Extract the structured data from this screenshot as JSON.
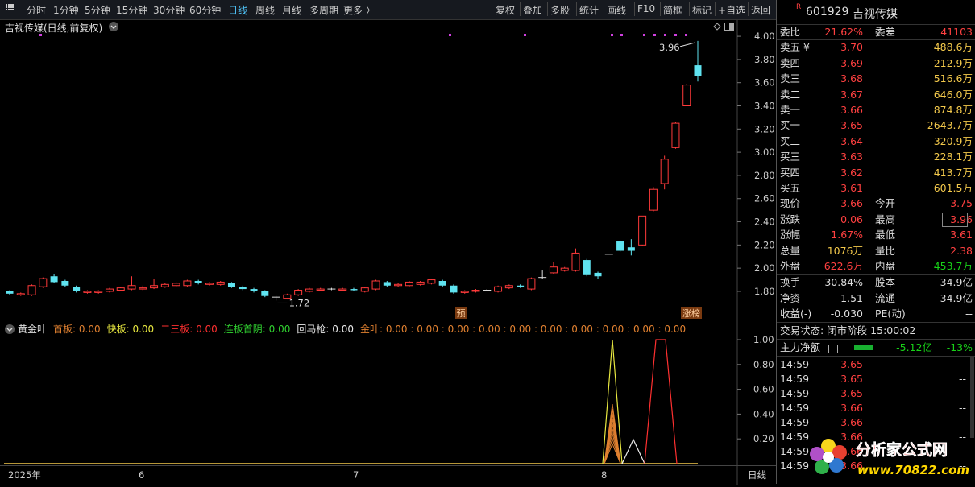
{
  "toolbar": {
    "periods": [
      "分时",
      "1分钟",
      "5分钟",
      "15分钟",
      "30分钟",
      "60分钟",
      "日线",
      "周线",
      "月线",
      "多周期",
      "更多 〉"
    ],
    "active_period": "日线",
    "right_buttons": [
      "复权",
      "叠加",
      "多股",
      "统计",
      "画线",
      "F10",
      "简框",
      "标记",
      "+自选",
      "返回"
    ]
  },
  "main_chart": {
    "title": "吉视传媒(日线,前复权)",
    "price_axis": [
      "4.00",
      "3.80",
      "3.60",
      "3.40",
      "3.20",
      "3.00",
      "2.80",
      "2.60",
      "2.40",
      "2.20",
      "2.00",
      "1.80"
    ],
    "high_label": "3.96",
    "low_label": "1.72",
    "markers": [
      "预",
      "涨榜"
    ]
  },
  "chart_data": {
    "type": "candlestick",
    "ylim": [
      1.72,
      4.05
    ],
    "candles": [
      {
        "o": 1.8,
        "c": 1.78,
        "h": 1.81,
        "l": 1.77
      },
      {
        "o": 1.77,
        "c": 1.78,
        "h": 1.79,
        "l": 1.76
      },
      {
        "o": 1.77,
        "c": 1.85,
        "h": 1.86,
        "l": 1.76
      },
      {
        "o": 1.84,
        "c": 1.91,
        "h": 1.92,
        "l": 1.83
      },
      {
        "o": 1.93,
        "c": 1.88,
        "h": 1.95,
        "l": 1.87
      },
      {
        "o": 1.89,
        "c": 1.85,
        "h": 1.9,
        "l": 1.84
      },
      {
        "o": 1.84,
        "c": 1.8,
        "h": 1.85,
        "l": 1.79
      },
      {
        "o": 1.79,
        "c": 1.8,
        "h": 1.81,
        "l": 1.78
      },
      {
        "o": 1.79,
        "c": 1.8,
        "h": 1.81,
        "l": 1.78
      },
      {
        "o": 1.8,
        "c": 1.82,
        "h": 1.83,
        "l": 1.79
      },
      {
        "o": 1.81,
        "c": 1.83,
        "h": 1.84,
        "l": 1.8
      },
      {
        "o": 1.82,
        "c": 1.85,
        "h": 1.93,
        "l": 1.81
      },
      {
        "o": 1.82,
        "c": 1.83,
        "h": 1.85,
        "l": 1.81
      },
      {
        "o": 1.83,
        "c": 1.85,
        "h": 1.91,
        "l": 1.82
      },
      {
        "o": 1.84,
        "c": 1.86,
        "h": 1.87,
        "l": 1.83
      },
      {
        "o": 1.85,
        "c": 1.87,
        "h": 1.88,
        "l": 1.84
      },
      {
        "o": 1.85,
        "c": 1.89,
        "h": 1.9,
        "l": 1.84
      },
      {
        "o": 1.89,
        "c": 1.87,
        "h": 1.9,
        "l": 1.86
      },
      {
        "o": 1.86,
        "c": 1.87,
        "h": 1.88,
        "l": 1.85
      },
      {
        "o": 1.86,
        "c": 1.88,
        "h": 1.89,
        "l": 1.85
      },
      {
        "o": 1.87,
        "c": 1.84,
        "h": 1.88,
        "l": 1.83
      },
      {
        "o": 1.84,
        "c": 1.82,
        "h": 1.85,
        "l": 1.81
      },
      {
        "o": 1.82,
        "c": 1.8,
        "h": 1.83,
        "l": 1.79
      },
      {
        "o": 1.8,
        "c": 1.76,
        "h": 1.81,
        "l": 1.75
      },
      {
        "o": 1.75,
        "c": 1.75,
        "h": 1.76,
        "l": 1.72
      },
      {
        "o": 1.74,
        "c": 1.77,
        "h": 1.78,
        "l": 1.73
      },
      {
        "o": 1.77,
        "c": 1.81,
        "h": 1.82,
        "l": 1.76
      },
      {
        "o": 1.8,
        "c": 1.82,
        "h": 1.83,
        "l": 1.79
      },
      {
        "o": 1.81,
        "c": 1.82,
        "h": 1.83,
        "l": 1.8
      },
      {
        "o": 1.82,
        "c": 1.82,
        "h": 1.83,
        "l": 1.81
      },
      {
        "o": 1.81,
        "c": 1.82,
        "h": 1.83,
        "l": 1.8
      },
      {
        "o": 1.82,
        "c": 1.81,
        "h": 1.83,
        "l": 1.8
      },
      {
        "o": 1.8,
        "c": 1.83,
        "h": 1.84,
        "l": 1.79
      },
      {
        "o": 1.82,
        "c": 1.89,
        "h": 1.9,
        "l": 1.81
      },
      {
        "o": 1.88,
        "c": 1.85,
        "h": 1.89,
        "l": 1.84
      },
      {
        "o": 1.85,
        "c": 1.86,
        "h": 1.87,
        "l": 1.84
      },
      {
        "o": 1.85,
        "c": 1.88,
        "h": 1.89,
        "l": 1.84
      },
      {
        "o": 1.86,
        "c": 1.88,
        "h": 1.89,
        "l": 1.85
      },
      {
        "o": 1.87,
        "c": 1.9,
        "h": 1.91,
        "l": 1.86
      },
      {
        "o": 1.89,
        "c": 1.85,
        "h": 1.9,
        "l": 1.84
      },
      {
        "o": 1.85,
        "c": 1.79,
        "h": 1.86,
        "l": 1.78
      },
      {
        "o": 1.79,
        "c": 1.8,
        "h": 1.81,
        "l": 1.78
      },
      {
        "o": 1.8,
        "c": 1.81,
        "h": 1.82,
        "l": 1.79
      },
      {
        "o": 1.81,
        "c": 1.81,
        "h": 1.82,
        "l": 1.8
      },
      {
        "o": 1.8,
        "c": 1.84,
        "h": 1.85,
        "l": 1.79
      },
      {
        "o": 1.83,
        "c": 1.85,
        "h": 1.86,
        "l": 1.82
      },
      {
        "o": 1.85,
        "c": 1.84,
        "h": 1.86,
        "l": 1.83
      },
      {
        "o": 1.82,
        "c": 1.91,
        "h": 1.92,
        "l": 1.81
      },
      {
        "o": 1.92,
        "c": 1.92,
        "h": 1.98,
        "l": 1.91
      },
      {
        "o": 1.96,
        "c": 2.01,
        "h": 2.05,
        "l": 1.95
      },
      {
        "o": 1.98,
        "c": 2.0,
        "h": 2.01,
        "l": 1.97
      },
      {
        "o": 1.98,
        "c": 2.13,
        "h": 2.17,
        "l": 1.97
      },
      {
        "o": 2.07,
        "c": 1.94,
        "h": 2.08,
        "l": 1.93
      },
      {
        "o": 1.96,
        "c": 1.93,
        "h": 1.97,
        "l": 1.91
      },
      {
        "o": 2.12,
        "c": 2.12,
        "h": 2.12,
        "l": 2.12
      },
      {
        "o": 2.23,
        "c": 2.15,
        "h": 2.24,
        "l": 2.14
      },
      {
        "o": 2.18,
        "c": 2.15,
        "h": 2.25,
        "l": 2.11
      },
      {
        "o": 2.2,
        "c": 2.45,
        "h": 2.45,
        "l": 2.19
      },
      {
        "o": 2.5,
        "c": 2.68,
        "h": 2.7,
        "l": 2.49
      },
      {
        "o": 2.73,
        "c": 2.94,
        "h": 2.97,
        "l": 2.68
      },
      {
        "o": 3.04,
        "c": 3.25,
        "h": 3.26,
        "l": 3.03
      },
      {
        "o": 3.4,
        "c": 3.58,
        "h": 3.59,
        "l": 3.4
      },
      {
        "o": 3.75,
        "c": 3.66,
        "h": 3.96,
        "l": 3.61
      }
    ]
  },
  "indicator": {
    "name": "黄金叶",
    "items": [
      {
        "label": "首板:",
        "value": "0.00",
        "color": "#e08030"
      },
      {
        "label": "快板:",
        "value": "0.00",
        "color": "#e8e840"
      },
      {
        "label": "二三板:",
        "value": "0.00",
        "color": "#ff3030"
      },
      {
        "label": "连板首阴:",
        "value": "0.00",
        "color": "#30d030"
      },
      {
        "label": "回马枪:",
        "value": "0.00",
        "color": "#e8e8e8"
      },
      {
        "label": "金叶:",
        "value": "0.00 : 0.00 : 0.00 : 0.00 : 0.00 : 0.00 : 0.00 : 0.00 : 0.00 : 0.00",
        "color": "#e08030"
      }
    ],
    "axis": [
      "1.00",
      "0.80",
      "0.60",
      "0.40",
      "0.20"
    ]
  },
  "x_axis": {
    "labels": [
      "2025年",
      "6",
      "7",
      "8"
    ],
    "period": "日线"
  },
  "quote": {
    "code": "601929",
    "name": "吉视传媒",
    "tag": "R",
    "weibi_label": "委比",
    "weibi": "21.62%",
    "weicha_label": "委差",
    "weicha": "41103",
    "asks": [
      {
        "label": "卖五 ¥",
        "price": "3.70",
        "vol": "488.6万"
      },
      {
        "label": "卖四",
        "price": "3.69",
        "vol": "212.9万"
      },
      {
        "label": "卖三",
        "price": "3.68",
        "vol": "516.6万"
      },
      {
        "label": "卖二",
        "price": "3.67",
        "vol": "646.0万"
      },
      {
        "label": "卖一",
        "price": "3.66",
        "vol": "874.8万"
      }
    ],
    "bids": [
      {
        "label": "买一",
        "price": "3.65",
        "vol": "2643.7万"
      },
      {
        "label": "买二",
        "price": "3.64",
        "vol": "320.9万"
      },
      {
        "label": "买三",
        "price": "3.63",
        "vol": "228.1万"
      },
      {
        "label": "买四",
        "price": "3.62",
        "vol": "413.7万"
      },
      {
        "label": "买五",
        "price": "3.61",
        "vol": "601.5万"
      }
    ],
    "stats": [
      {
        "l1": "现价",
        "v1": "3.66",
        "c1": "red",
        "l2": "今开",
        "v2": "3.75",
        "c2": "red"
      },
      {
        "l1": "涨跌",
        "v1": "0.06",
        "c1": "red",
        "l2": "最高",
        "v2": "3.96",
        "c2": "red"
      },
      {
        "l1": "涨幅",
        "v1": "1.67%",
        "c1": "red",
        "l2": "最低",
        "v2": "3.61",
        "c2": "red"
      },
      {
        "l1": "总量",
        "v1": "1076万",
        "c1": "yel",
        "l2": "量比",
        "v2": "2.38",
        "c2": "red"
      },
      {
        "l1": "外盘",
        "v1": "622.6万",
        "c1": "red",
        "l2": "内盘",
        "v2": "453.7万",
        "c2": "grn"
      }
    ],
    "stats2": [
      {
        "l1": "换手",
        "v1": "30.84%",
        "l2": "股本",
        "v2": "34.9亿"
      },
      {
        "l1": "净资",
        "v1": "1.51",
        "l2": "流通",
        "v2": "34.9亿"
      },
      {
        "l1": "收益(-)",
        "v1": "-0.030",
        "l2": "PE(动)",
        "v2": "--"
      }
    ],
    "trade_status": "交易状态: 闭市阶段 15:00:02",
    "main_flow_label": "主力净额",
    "main_flow_value": "-5.12亿",
    "main_flow_pct": "-13%",
    "ticks": [
      {
        "time": "14:59",
        "price": "3.65",
        "vol": "--"
      },
      {
        "time": "14:59",
        "price": "3.65",
        "vol": "--"
      },
      {
        "time": "14:59",
        "price": "3.65",
        "vol": "--"
      },
      {
        "time": "14:59",
        "price": "3.66",
        "vol": "--"
      },
      {
        "time": "14:59",
        "price": "3.66",
        "vol": "--"
      },
      {
        "time": "14:59",
        "price": "3.66",
        "vol": "--"
      },
      {
        "time": "14:59",
        "price": "3.66",
        "vol": "--"
      },
      {
        "time": "14:59",
        "price": "3.66",
        "vol": "--"
      }
    ]
  },
  "watermark": {
    "title": "分析家公式网",
    "url": "www.70822.com"
  }
}
